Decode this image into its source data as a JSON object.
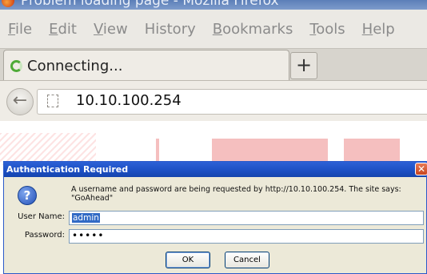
{
  "window": {
    "title": "Problem loading page - Mozilla Firefox"
  },
  "menubar": {
    "items": [
      {
        "ul": "F",
        "rest": "ile"
      },
      {
        "ul": "E",
        "rest": "dit"
      },
      {
        "ul": "V",
        "rest": "iew"
      },
      {
        "ul": "",
        "rest": "History"
      },
      {
        "ul": "B",
        "rest": "ookmarks"
      },
      {
        "ul": "T",
        "rest": "ools"
      },
      {
        "ul": "H",
        "rest": "elp"
      }
    ]
  },
  "tab": {
    "label": "Connecting...",
    "new_tab_symbol": "+"
  },
  "navbar": {
    "back_symbol": "←",
    "url": "10.10.100.254"
  },
  "dialog": {
    "title": "Authentication Required",
    "close_symbol": "✕",
    "help_symbol": "?",
    "message_line1": "A username and password are being requested by http://10.10.100.254. The site says:",
    "message_line2": "\"GoAhead\"",
    "username_label": "User Name:",
    "username_value": "admin",
    "password_label": "Password:",
    "password_value": "•••••",
    "ok_label": "OK",
    "cancel_label": "Cancel"
  },
  "colors": {
    "dialog_title_bg": "#1c4fc3",
    "dialog_bg": "#ece9d8",
    "selection": "#316ac5",
    "spinner": "#4faa38"
  },
  "icons": [
    "firefox-icon",
    "loading-spinner-icon",
    "back-arrow-icon",
    "site-identity-icon",
    "question-icon",
    "close-icon"
  ]
}
